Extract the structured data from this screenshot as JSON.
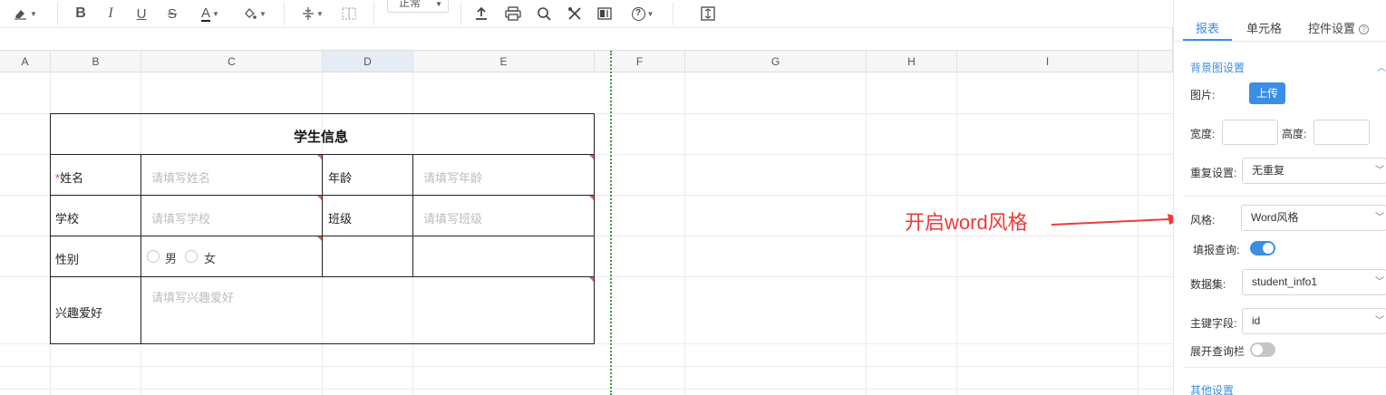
{
  "toolbar": {
    "font_size_value": "正常",
    "icons": [
      "eraser-icon",
      "bold-icon",
      "italic-icon",
      "underline-icon",
      "strikethrough-icon",
      "font-color-icon",
      "fill-color-icon",
      "vertical-align-icon",
      "merge-cells-icon",
      "upload-icon",
      "print-icon",
      "search-icon",
      "tools-icon",
      "chart-icon",
      "help-icon",
      "fullscreen-icon"
    ]
  },
  "grid": {
    "columns": [
      "A",
      "B",
      "C",
      "D",
      "E",
      "F",
      "G",
      "H",
      "I"
    ],
    "selected_column": "D"
  },
  "form": {
    "title": "学生信息",
    "required_mark": "*",
    "name_label": "姓名",
    "name_placeholder": "请填写姓名",
    "age_label": "年龄",
    "age_placeholder": "请填写年龄",
    "school_label": "学校",
    "school_placeholder": "请填写学校",
    "class_label": "班级",
    "class_placeholder": "请填写班级",
    "gender_label": "性别",
    "gender_options": [
      "男",
      "女"
    ],
    "hobby_label": "兴趣爱好",
    "hobby_placeholder": "请填写兴趣爱好"
  },
  "annotation": {
    "text": "开启word风格",
    "color": "#ee3a3a"
  },
  "panel": {
    "tabs": [
      "报表",
      "单元格",
      "控件设置"
    ],
    "active_tab": "报表",
    "background_section": "背景图设置",
    "image_label": "图片:",
    "upload_button": "上传",
    "width_label": "宽度:",
    "height_label": "高度:",
    "repeat_label": "重复设置:",
    "repeat_value": "无重复",
    "style_label": "风格:",
    "style_value": "Word风格",
    "fill_query_label": "填报查询:",
    "fill_query_on": true,
    "dataset_label": "数据集:",
    "dataset_value": "student_info1",
    "primary_key_label": "主键字段:",
    "primary_key_value": "id",
    "expand_query_label": "展开查询栏",
    "expand_query_on": false,
    "other_section": "其他设置",
    "accent_color": "#3a8ee6"
  }
}
